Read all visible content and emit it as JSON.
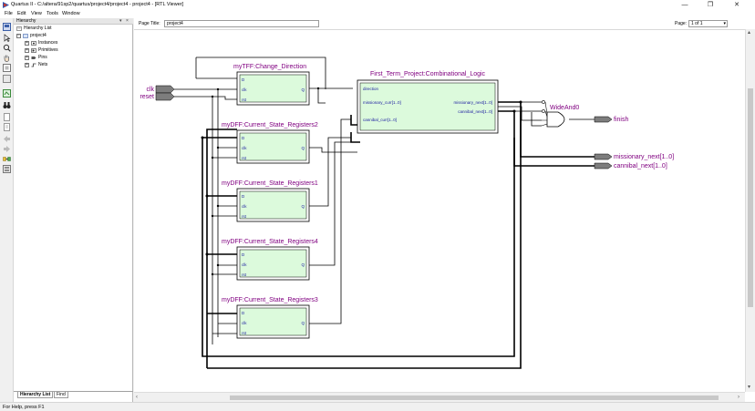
{
  "window": {
    "title": "Quartus II - C:/altera/91sp2/quartus/project4/project4 - project4 - [RTL Viewer]",
    "controls": {
      "minimize": "—",
      "maximize": "❐",
      "close": "✕"
    }
  },
  "menu": {
    "file": "File",
    "edit": "Edit",
    "view": "View",
    "tools": "Tools",
    "window": "Window"
  },
  "hierarchy": {
    "header": "Hierarchy",
    "controls": {
      "dropdown": "▾",
      "close": "×"
    },
    "root_label": "Hierarchy List",
    "project_label": "project4",
    "items": [
      "Instances",
      "Primitives",
      "Pins",
      "Nets"
    ],
    "tabs": [
      "Hierarchy List",
      "Find"
    ]
  },
  "viewer": {
    "page_title_label": "Page Title:",
    "page_title_value": "project4",
    "page_label": "Page:",
    "page_value": "1 of 1"
  },
  "schematic": {
    "inputs": [
      "clk",
      "reset"
    ],
    "tff": {
      "name": "myTFF:Change_Direction",
      "ports": [
        "D",
        "clk",
        "rst"
      ],
      "out": "Q"
    },
    "dffs": [
      {
        "name": "myDFF:Current_State_Registers2",
        "ports": [
          "D",
          "clk",
          "rst"
        ],
        "out": "Q"
      },
      {
        "name": "myDFF:Current_State_Registers1",
        "ports": [
          "D",
          "clk",
          "rst"
        ],
        "out": "Q"
      },
      {
        "name": "myDFF:Current_State_Registers4",
        "ports": [
          "D",
          "clk",
          "rst"
        ],
        "out": "Q"
      },
      {
        "name": "myDFF:Current_State_Registers3",
        "ports": [
          "D",
          "clk",
          "rst"
        ],
        "out": "Q"
      }
    ],
    "logic": {
      "name": "First_Term_Project:Combinational_Logic",
      "in_ports": [
        "direction",
        "missionary_curr[1..0]",
        "cannibal_curr[1..0]"
      ],
      "out_ports": [
        "missionary_next[1..0]",
        "cannibal_next[1..0]"
      ]
    },
    "gate": "WideAnd0",
    "outputs": [
      "finish",
      "missionary_next[1..0]",
      "cannibal_next[1..0]"
    ]
  },
  "status": {
    "text": "For Help, press F1"
  },
  "colors": {
    "module_name": "#800080",
    "port_text": "#1a1aa0",
    "block_fill": "#dcfadc",
    "wire": "#000000",
    "pin_fill": "#7d7d7d"
  }
}
